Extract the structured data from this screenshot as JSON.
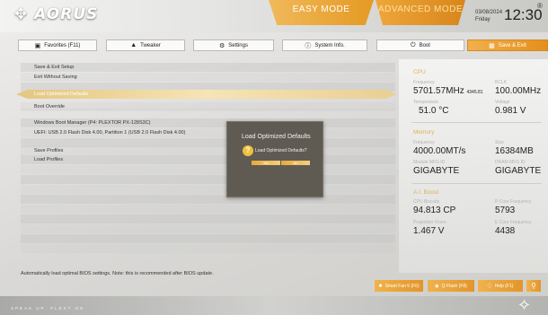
{
  "header": {
    "logo": "AORUS",
    "mode_easy": "EASY MODE",
    "mode_advanced": "ADVANCED MODE",
    "date": "03/08/2024",
    "day": "Friday",
    "time": "12:30",
    "reg_symbol": "®"
  },
  "tabs": [
    {
      "label": "Favorites (F11)",
      "icon": "star-folder-icon"
    },
    {
      "label": "Tweaker",
      "icon": "car-icon"
    },
    {
      "label": "Settings",
      "icon": "gear-icon"
    },
    {
      "label": "System Info.",
      "icon": "info-icon"
    },
    {
      "label": "Boot",
      "icon": "power-icon"
    },
    {
      "label": "Save & Exit",
      "icon": "save-exit-icon"
    }
  ],
  "menu": {
    "save_exit_setup": "Save & Exit Setup",
    "exit_without_saving": "Exit Without Saving",
    "load_optimized_defaults": "Load Optimized Defaults",
    "boot_override": "Boot Override",
    "boot_manager": "Windows Boot Manager (P4: PLEXTOR PX-128S3C)",
    "uefi_usb": "UEFI: USB 2.0 Flash Disk 4.00, Partition 1 (USB 2.0 Flash Disk 4.00)",
    "save_profiles": "Save Profiles",
    "load_profiles": "Load Profiles"
  },
  "status_text": "Automatically load optimal BIOS settings. Note: this is recommended after BIOS update.",
  "dialog": {
    "title": "Load Optimized Defaults",
    "message": "Load Optimized Defaults?",
    "yes_label": "Yes",
    "no_label": "No"
  },
  "info": {
    "cpu_title": "CPU",
    "freq_label": "Frequency",
    "freq_value": "5701.57MHz",
    "freq_sub": "4345.81",
    "bclk_label": "BCLK",
    "bclk_value": "100.00MHz",
    "temp_label": "Temperature",
    "temp_value": "51.0 °C",
    "voltage_label": "Voltage",
    "voltage_value": "0.981 V",
    "mem_title": "Memory",
    "mem_freq_label": "Frequency",
    "mem_freq_value": "4000.00MT/s",
    "size_label": "Size",
    "size_value": "16384MB",
    "module_label": "Module MFG ID",
    "module_value": "GIGABYTE",
    "dram_label": "DRAM MFG ID",
    "dram_value": "GIGABYTE",
    "boost_title": "A.I. Boost",
    "cpu_biscuits_label": "CPU Biscuits",
    "cpu_biscuits_value": "94.813 CP",
    "pcore_label": "P Core Frequency",
    "pcore_value": "5793",
    "proj_label": "Projection Vcore",
    "proj_value": "1.467 V",
    "ecore_label": "E Core Frequency",
    "ecore_value": "4438"
  },
  "bottom": {
    "smart_fan": "Smart Fan 6 (F6)",
    "qflash": "Q-Flash (F8)",
    "help": "Help (F1)",
    "search_icon": "search-icon"
  },
  "footer": {
    "text": "SPEAK UP. FLEXT ON"
  },
  "colors": {
    "accent": "#e8a030",
    "panel_bg": "#5f5b52"
  }
}
